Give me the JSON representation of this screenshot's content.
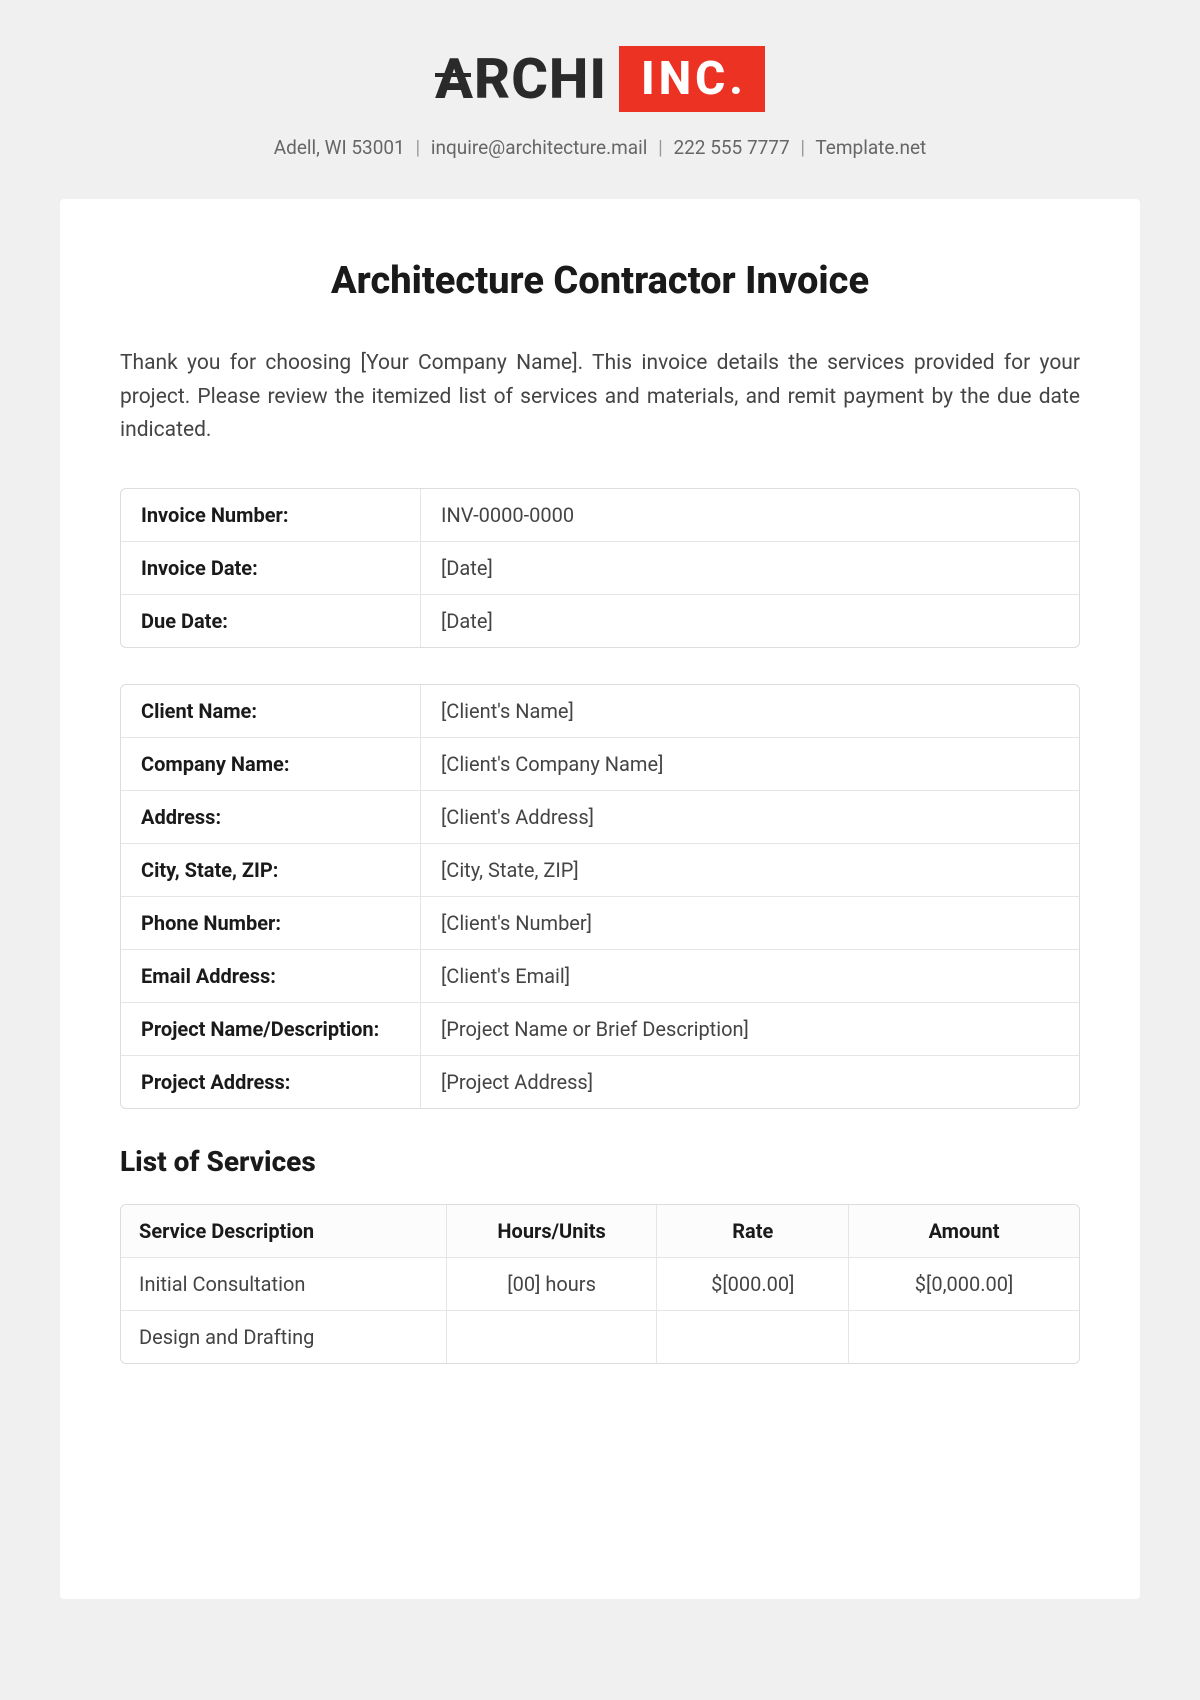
{
  "header": {
    "logo_left": "ARCHI",
    "logo_right": "INC.",
    "contact": {
      "address": "Adell, WI 53001",
      "email": "inquire@architecture.mail",
      "phone": "222 555 7777",
      "site": "Template.net"
    }
  },
  "title": "Architecture Contractor Invoice",
  "intro": "Thank you for choosing [Your Company Name]. This invoice details the services provided for your project. Please review the itemized list of services and materials, and remit payment by the due date indicated.",
  "invoice_meta": [
    {
      "label": "Invoice Number:",
      "value": "INV-0000-0000"
    },
    {
      "label": "Invoice Date:",
      "value": "[Date]"
    },
    {
      "label": "Due Date:",
      "value": "[Date]"
    }
  ],
  "client_meta": [
    {
      "label": "Client Name:",
      "value": "[Client's Name]"
    },
    {
      "label": "Company Name:",
      "value": "[Client's Company Name]"
    },
    {
      "label": "Address:",
      "value": "[Client's Address]"
    },
    {
      "label": "City, State, ZIP:",
      "value": "[City, State, ZIP]"
    },
    {
      "label": "Phone Number:",
      "value": "[Client's Number]"
    },
    {
      "label": "Email Address:",
      "value": "[Client's Email]"
    },
    {
      "label": "Project Name/Description:",
      "value": "[Project Name or Brief Description]"
    },
    {
      "label": "Project Address:",
      "value": "[Project Address]"
    }
  ],
  "services_heading": "List of Services",
  "services_headers": {
    "desc": "Service Description",
    "hours": "Hours/Units",
    "rate": "Rate",
    "amount": "Amount"
  },
  "services_rows": [
    {
      "desc": "Initial Consultation",
      "hours": "[00] hours",
      "rate": "$[000.00]",
      "amount": "$[0,000.00]"
    },
    {
      "desc": "Design and Drafting",
      "hours": "",
      "rate": "",
      "amount": ""
    }
  ]
}
